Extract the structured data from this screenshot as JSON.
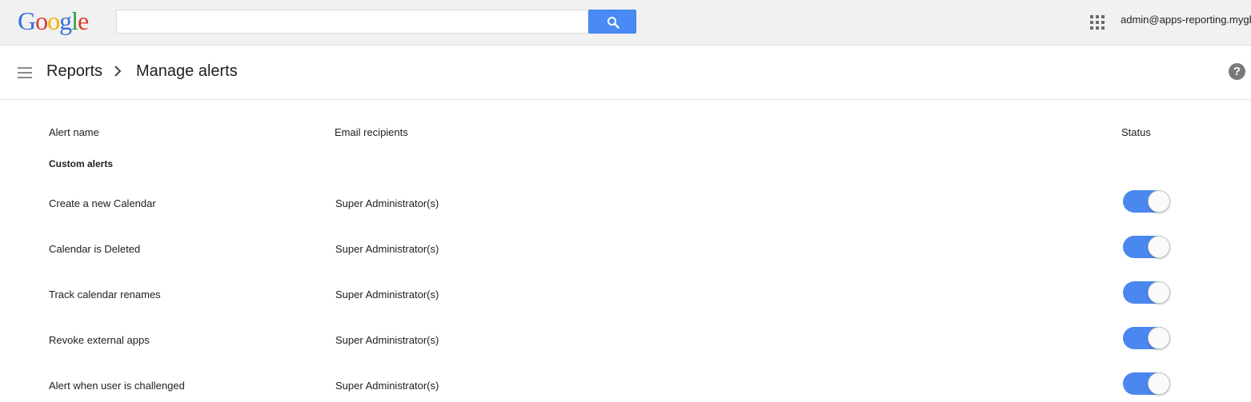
{
  "topbar": {
    "logo_letters": [
      {
        "char": "G",
        "color": "#3b6fdc"
      },
      {
        "char": "o",
        "color": "#dc3b2c"
      },
      {
        "char": "o",
        "color": "#f2b100"
      },
      {
        "char": "g",
        "color": "#3b6fdc"
      },
      {
        "char": "l",
        "color": "#2f9e44"
      },
      {
        "char": "e",
        "color": "#dc3b2c"
      }
    ],
    "search": {
      "value": "",
      "placeholder": "",
      "button_icon": "search-icon"
    },
    "apps_icon": "apps-grid-icon",
    "account": "admin@apps-reporting.mygb"
  },
  "header": {
    "menu_icon": "hamburger-menu-icon",
    "breadcrumb_root": "Reports",
    "breadcrumb_separator_icon": "chevron-right-icon",
    "title": "Manage alerts",
    "help_icon": "help-icon"
  },
  "table": {
    "columns": {
      "name": "Alert name",
      "recipients": "Email recipients",
      "status": "Status"
    },
    "group_label": "Custom alerts",
    "rows": [
      {
        "name": "Create a new Calendar",
        "recipients": "Super Administrator(s)",
        "enabled": true
      },
      {
        "name": "Calendar is Deleted",
        "recipients": "Super Administrator(s)",
        "enabled": true
      },
      {
        "name": "Track calendar renames",
        "recipients": "Super Administrator(s)",
        "enabled": true
      },
      {
        "name": "Revoke external apps",
        "recipients": "Super Administrator(s)",
        "enabled": true
      },
      {
        "name": "Alert when user is challenged",
        "recipients": "Super Administrator(s)",
        "enabled": true
      }
    ]
  },
  "colors": {
    "accent": "#4a87ee",
    "search_button": "#4a8af4",
    "topbar_bg": "#f1f1f1"
  }
}
